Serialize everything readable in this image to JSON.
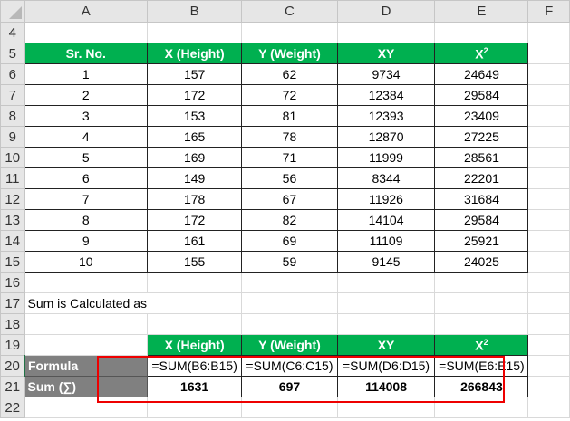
{
  "columns": [
    "A",
    "B",
    "C",
    "D",
    "E",
    "F"
  ],
  "row_numbers": [
    "4",
    "5",
    "6",
    "7",
    "8",
    "9",
    "10",
    "11",
    "12",
    "13",
    "14",
    "15",
    "16",
    "17",
    "18",
    "19",
    "20",
    "21",
    "22"
  ],
  "table": {
    "headers": [
      "Sr. No.",
      "X (Height)",
      "Y (Weight)",
      "XY",
      "X",
      "2"
    ],
    "rows": [
      [
        "1",
        "157",
        "62",
        "9734",
        "24649"
      ],
      [
        "2",
        "172",
        "72",
        "12384",
        "29584"
      ],
      [
        "3",
        "153",
        "81",
        "12393",
        "23409"
      ],
      [
        "4",
        "165",
        "78",
        "12870",
        "27225"
      ],
      [
        "5",
        "169",
        "71",
        "11999",
        "28561"
      ],
      [
        "6",
        "149",
        "56",
        "8344",
        "22201"
      ],
      [
        "7",
        "178",
        "67",
        "11926",
        "31684"
      ],
      [
        "8",
        "172",
        "82",
        "14104",
        "29584"
      ],
      [
        "9",
        "161",
        "69",
        "11109",
        "25921"
      ],
      [
        "10",
        "155",
        "59",
        "9145",
        "24025"
      ]
    ]
  },
  "note": "Sum is Calculated as",
  "sum_table": {
    "headers": [
      "X (Height)",
      "Y (Weight)",
      "XY",
      "X",
      "2"
    ],
    "formula_label": "Formula",
    "formulas": [
      "=SUM(B6:B15)",
      "=SUM(C6:C15)",
      "=SUM(D6:D15)",
      "=SUM(E6:E15)"
    ],
    "sum_label": "Sum (∑)",
    "sums": [
      "1631",
      "697",
      "114008",
      "266843"
    ]
  },
  "colors": {
    "header_green": "#00b050",
    "label_gray": "#808080",
    "highlight_red": "#e00000"
  }
}
